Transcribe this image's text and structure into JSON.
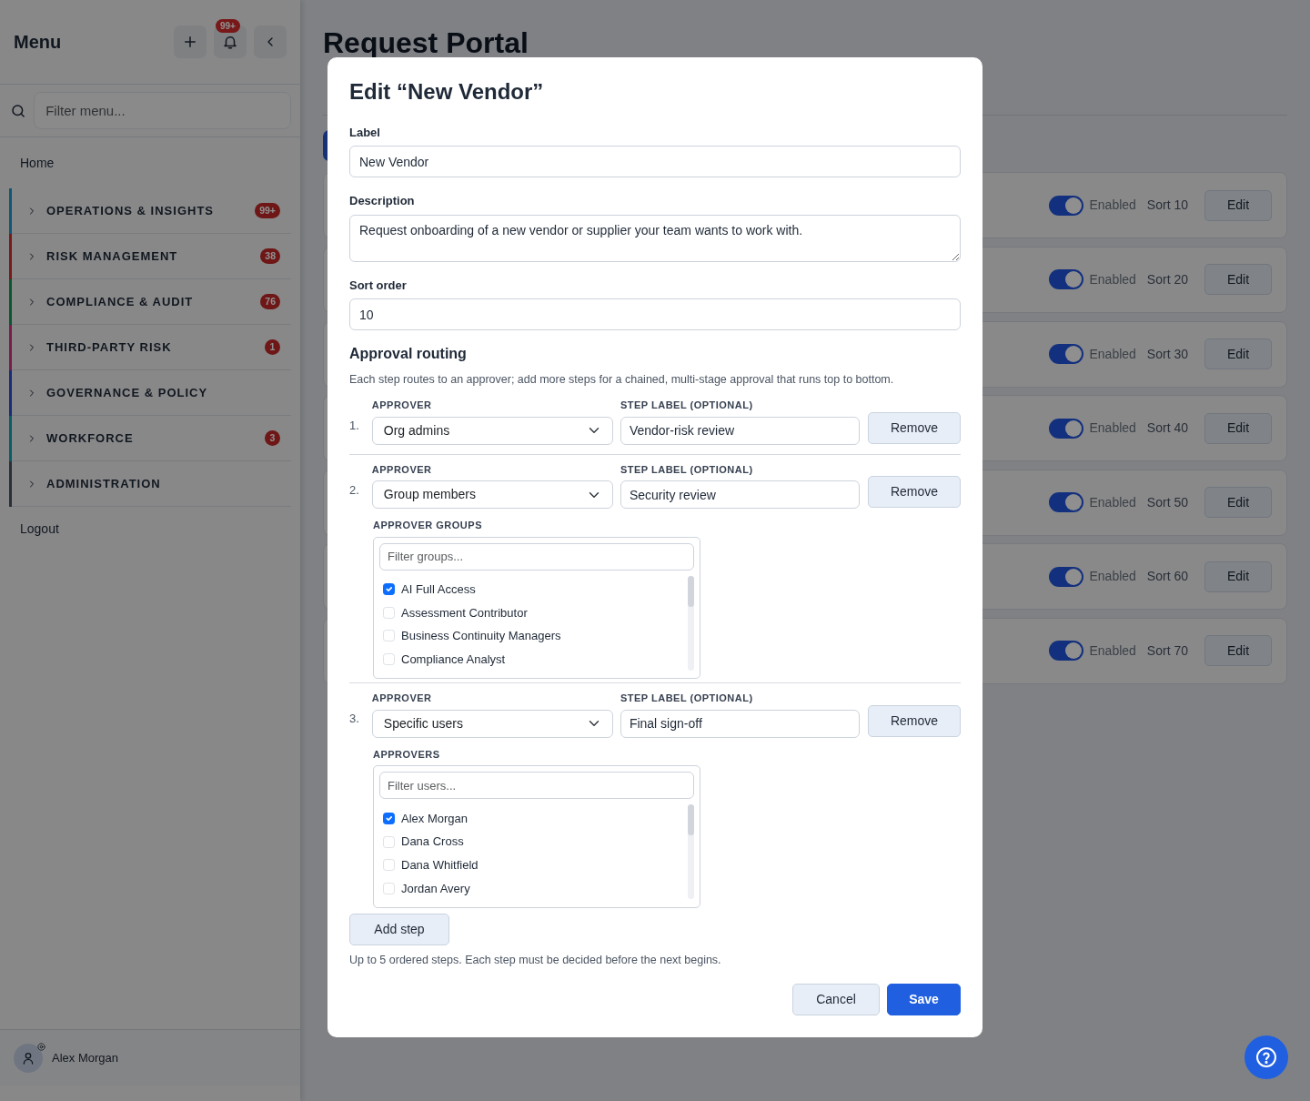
{
  "sidebar": {
    "title": "Menu",
    "notification_badge": "99+",
    "filter_placeholder": "Filter menu...",
    "home": "Home",
    "sections": [
      {
        "label": "OPERATIONS & INSIGHTS",
        "badge": "99+",
        "color": "#105775"
      },
      {
        "label": "RISK MANAGEMENT",
        "badge": "38",
        "color": "#761a1a"
      },
      {
        "label": "COMPLIANCE & AUDIT",
        "badge": "76",
        "color": "#085831"
      },
      {
        "label": "THIRD-PARTY RISK",
        "badge": "1",
        "color": "#781d4a"
      },
      {
        "label": "GOVERNANCE & POLICY",
        "color": "#182c79"
      },
      {
        "label": "WORKFORCE",
        "badge": "3",
        "color": "#0a5c67"
      },
      {
        "label": "ADMINISTRATION",
        "color": "#2a3037"
      }
    ],
    "logout": "Logout",
    "user": "Alex Morgan"
  },
  "page": {
    "title": "Request Portal",
    "items": [
      {
        "enabled": true,
        "status": "Enabled",
        "sort": "Sort 10",
        "action": "Edit"
      },
      {
        "enabled": true,
        "status": "Enabled",
        "sort": "Sort 20",
        "action": "Edit"
      },
      {
        "enabled": true,
        "status": "Enabled",
        "sort": "Sort 30",
        "action": "Edit"
      },
      {
        "enabled": true,
        "status": "Enabled",
        "sort": "Sort 40",
        "action": "Edit"
      },
      {
        "enabled": true,
        "status": "Enabled",
        "sort": "Sort 50",
        "action": "Edit"
      },
      {
        "enabled": true,
        "status": "Enabled",
        "sort": "Sort 60",
        "action": "Edit"
      },
      {
        "enabled": true,
        "status": "Enabled",
        "sort": "Sort 70",
        "action": "Edit"
      }
    ]
  },
  "modal": {
    "title": "Edit “New Vendor”",
    "label_field": {
      "label": "Label",
      "value": "New Vendor"
    },
    "description_field": {
      "label": "Description",
      "value": "Request onboarding of a new vendor or supplier your team wants to work with."
    },
    "sort_field": {
      "label": "Sort order",
      "value": "10"
    },
    "routing": {
      "title": "Approval routing",
      "help": "Each step routes to an approver; add more steps for a chained, multi-stage approval that runs top to bottom.",
      "steps": [
        {
          "number": "1.",
          "approver_label": "APPROVER",
          "approver": "Org admins",
          "step_label_label": "STEP LABEL (OPTIONAL)",
          "step_label": "Vendor-risk review",
          "remove": "Remove"
        },
        {
          "number": "2.",
          "approver_label": "APPROVER",
          "approver": "Group members",
          "step_label_label": "STEP LABEL (OPTIONAL)",
          "step_label": "Security review",
          "remove": "Remove",
          "picker": {
            "label": "APPROVER GROUPS",
            "placeholder": "Filter groups...",
            "options": [
              {
                "label": "AI Full Access",
                "checked": true
              },
              {
                "label": "Assessment Contributor",
                "checked": false
              },
              {
                "label": "Business Continuity Managers",
                "checked": false
              },
              {
                "label": "Compliance Analyst",
                "checked": false
              }
            ]
          }
        },
        {
          "number": "3.",
          "approver_label": "APPROVER",
          "approver": "Specific users",
          "step_label_label": "STEP LABEL (OPTIONAL)",
          "step_label": "Final sign-off",
          "remove": "Remove",
          "picker": {
            "label": "APPROVERS",
            "placeholder": "Filter users...",
            "options": [
              {
                "label": "Alex Morgan",
                "checked": true
              },
              {
                "label": "Dana Cross",
                "checked": false
              },
              {
                "label": "Dana Whitfield",
                "checked": false
              },
              {
                "label": "Jordan Avery",
                "checked": false
              }
            ]
          }
        }
      ],
      "add_step": "Add step",
      "hint": "Up to 5 ordered steps. Each step must be decided before the next begins."
    },
    "buttons": {
      "cancel": "Cancel",
      "save": "Save"
    }
  }
}
